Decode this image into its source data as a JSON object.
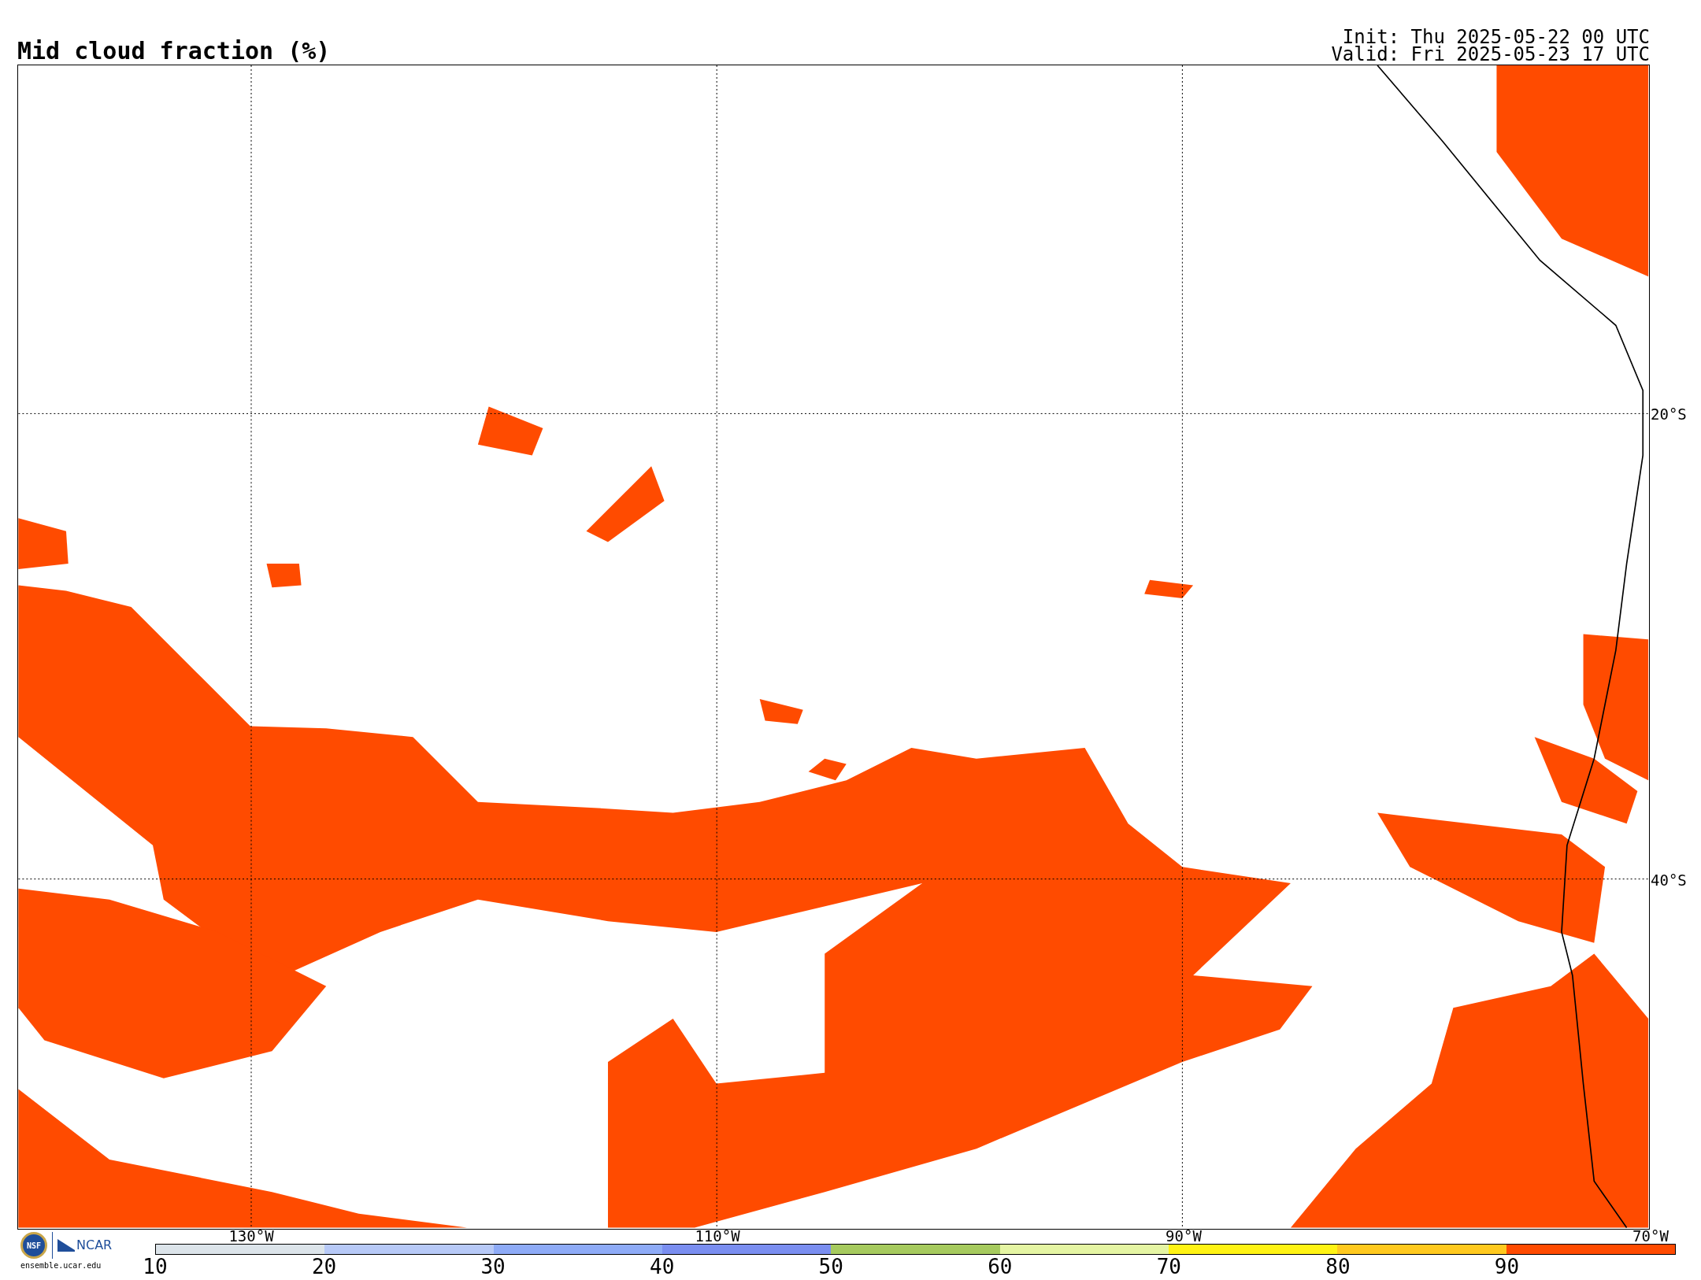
{
  "title": "Mid cloud fraction (%)",
  "run_info": [
    "Init: Thu 2025-05-22 00 UTC",
    "Valid: Fri 2025-05-23 17 UTC"
  ],
  "map": {
    "lat_labels": [
      "20°S",
      "40°S"
    ],
    "lon_labels": [
      "130°W",
      "110°W",
      "90°W",
      "70°W"
    ]
  },
  "logo": {
    "seal_text": "NSF",
    "org_text": "NCAR",
    "url": "ensemble.ucar.edu"
  },
  "colorbar": {
    "segments": [
      {
        "label": "10",
        "color": "#dce4ea"
      },
      {
        "label": "20",
        "color": "#b7c9f7"
      },
      {
        "label": "30",
        "color": "#8eabf7"
      },
      {
        "label": "40",
        "color": "#7a8ef0"
      },
      {
        "label": "50",
        "color": "#a6ca5e"
      },
      {
        "label": "60",
        "color": "#e5f5a3"
      },
      {
        "label": "70",
        "color": "#fff314"
      },
      {
        "label": "80",
        "color": "#ffc91f"
      },
      {
        "label": "90",
        "color": "#ff4b00"
      }
    ]
  }
}
